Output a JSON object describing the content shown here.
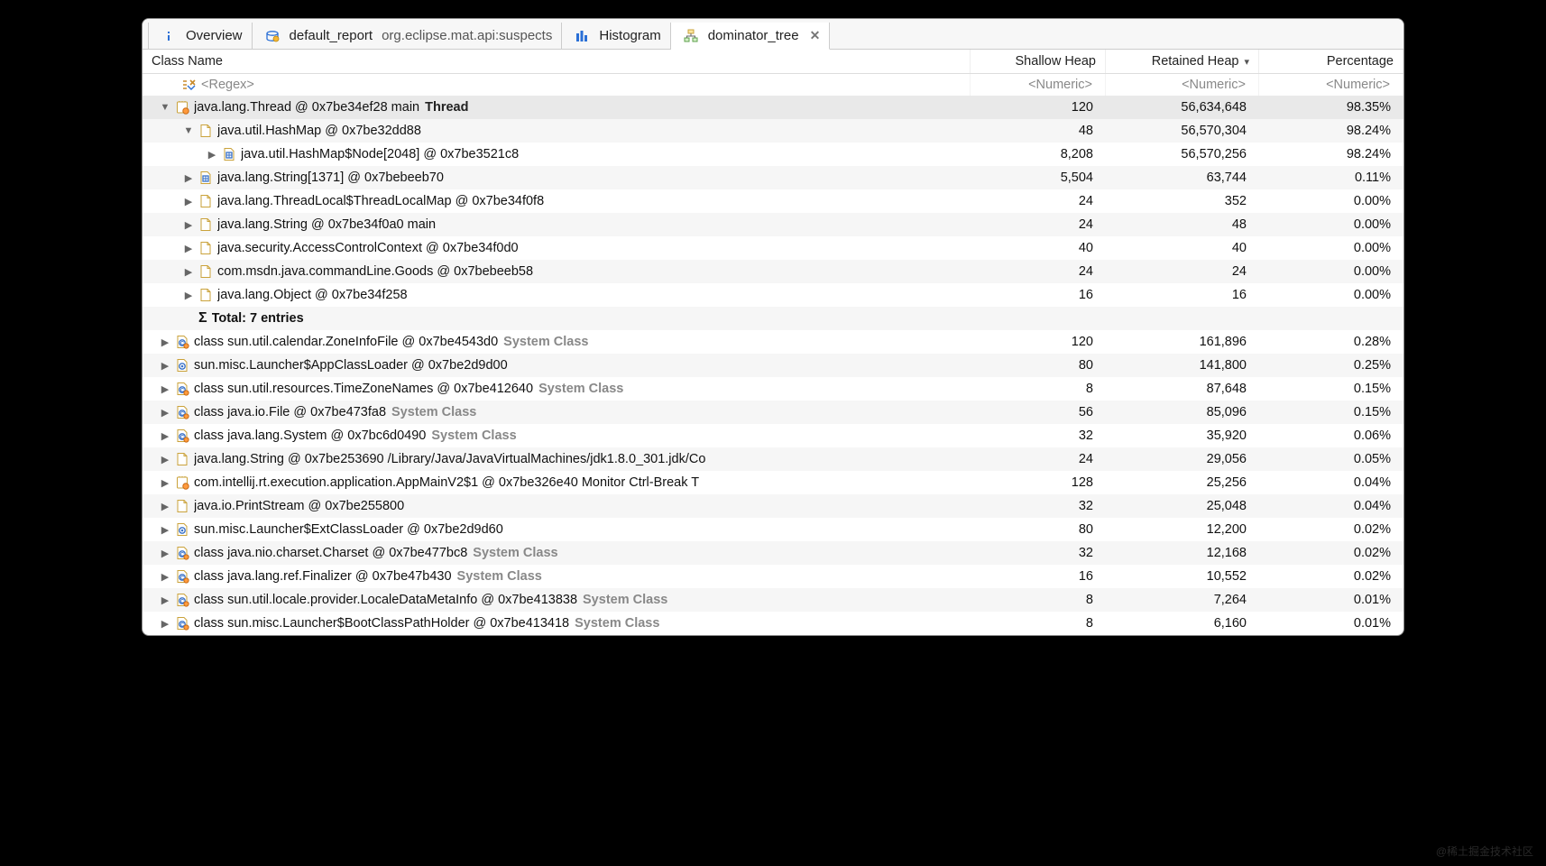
{
  "tabs": {
    "overview": "Overview",
    "report": "default_report",
    "report_suffix": "org.eclipse.mat.api:suspects",
    "histogram": "Histogram",
    "dominator": "dominator_tree"
  },
  "columns": {
    "name": "Class Name",
    "shallow": "Shallow Heap",
    "retained": "Retained Heap",
    "percentage": "Percentage"
  },
  "filters": {
    "name": "<Regex>",
    "shallow": "<Numeric>",
    "retained": "<Numeric>",
    "percentage": "<Numeric>"
  },
  "rows": [
    {
      "indent": 0,
      "arrow": "down",
      "icon": "thread",
      "text": "java.lang.Thread @ 0x7be34ef28  main",
      "bold_suffix": "Thread",
      "shallow": "120",
      "retained": "56,634,648",
      "percent": "98.35%",
      "selected": true
    },
    {
      "indent": 1,
      "arrow": "down",
      "icon": "file",
      "text": "java.util.HashMap @ 0x7be32dd88",
      "shallow": "48",
      "retained": "56,570,304",
      "percent": "98.24%"
    },
    {
      "indent": 2,
      "arrow": "right",
      "icon": "array",
      "text": "java.util.HashMap$Node[2048] @ 0x7be3521c8",
      "shallow": "8,208",
      "retained": "56,570,256",
      "percent": "98.24%"
    },
    {
      "indent": 1,
      "arrow": "right",
      "icon": "array",
      "text": "java.lang.String[1371] @ 0x7bebeeb70",
      "shallow": "5,504",
      "retained": "63,744",
      "percent": "0.11%"
    },
    {
      "indent": 1,
      "arrow": "right",
      "icon": "file",
      "text": "java.lang.ThreadLocal$ThreadLocalMap @ 0x7be34f0f8",
      "shallow": "24",
      "retained": "352",
      "percent": "0.00%"
    },
    {
      "indent": 1,
      "arrow": "right",
      "icon": "file",
      "text": "java.lang.String @ 0x7be34f0a0  main",
      "shallow": "24",
      "retained": "48",
      "percent": "0.00%"
    },
    {
      "indent": 1,
      "arrow": "right",
      "icon": "file",
      "text": "java.security.AccessControlContext @ 0x7be34f0d0",
      "shallow": "40",
      "retained": "40",
      "percent": "0.00%"
    },
    {
      "indent": 1,
      "arrow": "right",
      "icon": "file",
      "text": "com.msdn.java.commandLine.Goods @ 0x7bebeeb58",
      "shallow": "24",
      "retained": "24",
      "percent": "0.00%"
    },
    {
      "indent": 1,
      "arrow": "right",
      "icon": "file",
      "text": "java.lang.Object @ 0x7be34f258",
      "shallow": "16",
      "retained": "16",
      "percent": "0.00%"
    },
    {
      "indent": 1,
      "arrow": "none",
      "icon": "sigma",
      "text": "Total: 7 entries",
      "shallow": "",
      "retained": "",
      "percent": "",
      "total": true
    },
    {
      "indent": 0,
      "arrow": "right",
      "icon": "class",
      "text": "class sun.util.calendar.ZoneInfoFile @ 0x7be4543d0",
      "suffix": "System Class",
      "shallow": "120",
      "retained": "161,896",
      "percent": "0.28%"
    },
    {
      "indent": 0,
      "arrow": "right",
      "icon": "loader",
      "text": "sun.misc.Launcher$AppClassLoader @ 0x7be2d9d00",
      "shallow": "80",
      "retained": "141,800",
      "percent": "0.25%"
    },
    {
      "indent": 0,
      "arrow": "right",
      "icon": "class",
      "text": "class sun.util.resources.TimeZoneNames @ 0x7be412640",
      "suffix": "System Class",
      "shallow": "8",
      "retained": "87,648",
      "percent": "0.15%"
    },
    {
      "indent": 0,
      "arrow": "right",
      "icon": "class",
      "text": "class java.io.File @ 0x7be473fa8",
      "suffix": "System Class",
      "shallow": "56",
      "retained": "85,096",
      "percent": "0.15%"
    },
    {
      "indent": 0,
      "arrow": "right",
      "icon": "class",
      "text": "class java.lang.System @ 0x7bc6d0490",
      "suffix": "System Class",
      "shallow": "32",
      "retained": "35,920",
      "percent": "0.06%"
    },
    {
      "indent": 0,
      "arrow": "right",
      "icon": "file",
      "text": "java.lang.String @ 0x7be253690  /Library/Java/JavaVirtualMachines/jdk1.8.0_301.jdk/Co",
      "shallow": "24",
      "retained": "29,056",
      "percent": "0.05%"
    },
    {
      "indent": 0,
      "arrow": "right",
      "icon": "thread",
      "text": "com.intellij.rt.execution.application.AppMainV2$1 @ 0x7be326e40  Monitor Ctrl-Break T",
      "shallow": "128",
      "retained": "25,256",
      "percent": "0.04%"
    },
    {
      "indent": 0,
      "arrow": "right",
      "icon": "file",
      "text": "java.io.PrintStream @ 0x7be255800",
      "shallow": "32",
      "retained": "25,048",
      "percent": "0.04%"
    },
    {
      "indent": 0,
      "arrow": "right",
      "icon": "loader",
      "text": "sun.misc.Launcher$ExtClassLoader @ 0x7be2d9d60",
      "shallow": "80",
      "retained": "12,200",
      "percent": "0.02%"
    },
    {
      "indent": 0,
      "arrow": "right",
      "icon": "class",
      "text": "class java.nio.charset.Charset @ 0x7be477bc8",
      "suffix": "System Class",
      "shallow": "32",
      "retained": "12,168",
      "percent": "0.02%"
    },
    {
      "indent": 0,
      "arrow": "right",
      "icon": "class",
      "text": "class java.lang.ref.Finalizer @ 0x7be47b430",
      "suffix": "System Class",
      "shallow": "16",
      "retained": "10,552",
      "percent": "0.02%"
    },
    {
      "indent": 0,
      "arrow": "right",
      "icon": "class",
      "text": "class sun.util.locale.provider.LocaleDataMetaInfo @ 0x7be413838",
      "suffix": "System Class",
      "shallow": "8",
      "retained": "7,264",
      "percent": "0.01%"
    },
    {
      "indent": 0,
      "arrow": "right",
      "icon": "class",
      "text": "class sun.misc.Launcher$BootClassPathHolder @ 0x7be413418",
      "suffix": "System Class",
      "shallow": "8",
      "retained": "6,160",
      "percent": "0.01%"
    }
  ],
  "watermark": "@稀土掘金技术社区"
}
